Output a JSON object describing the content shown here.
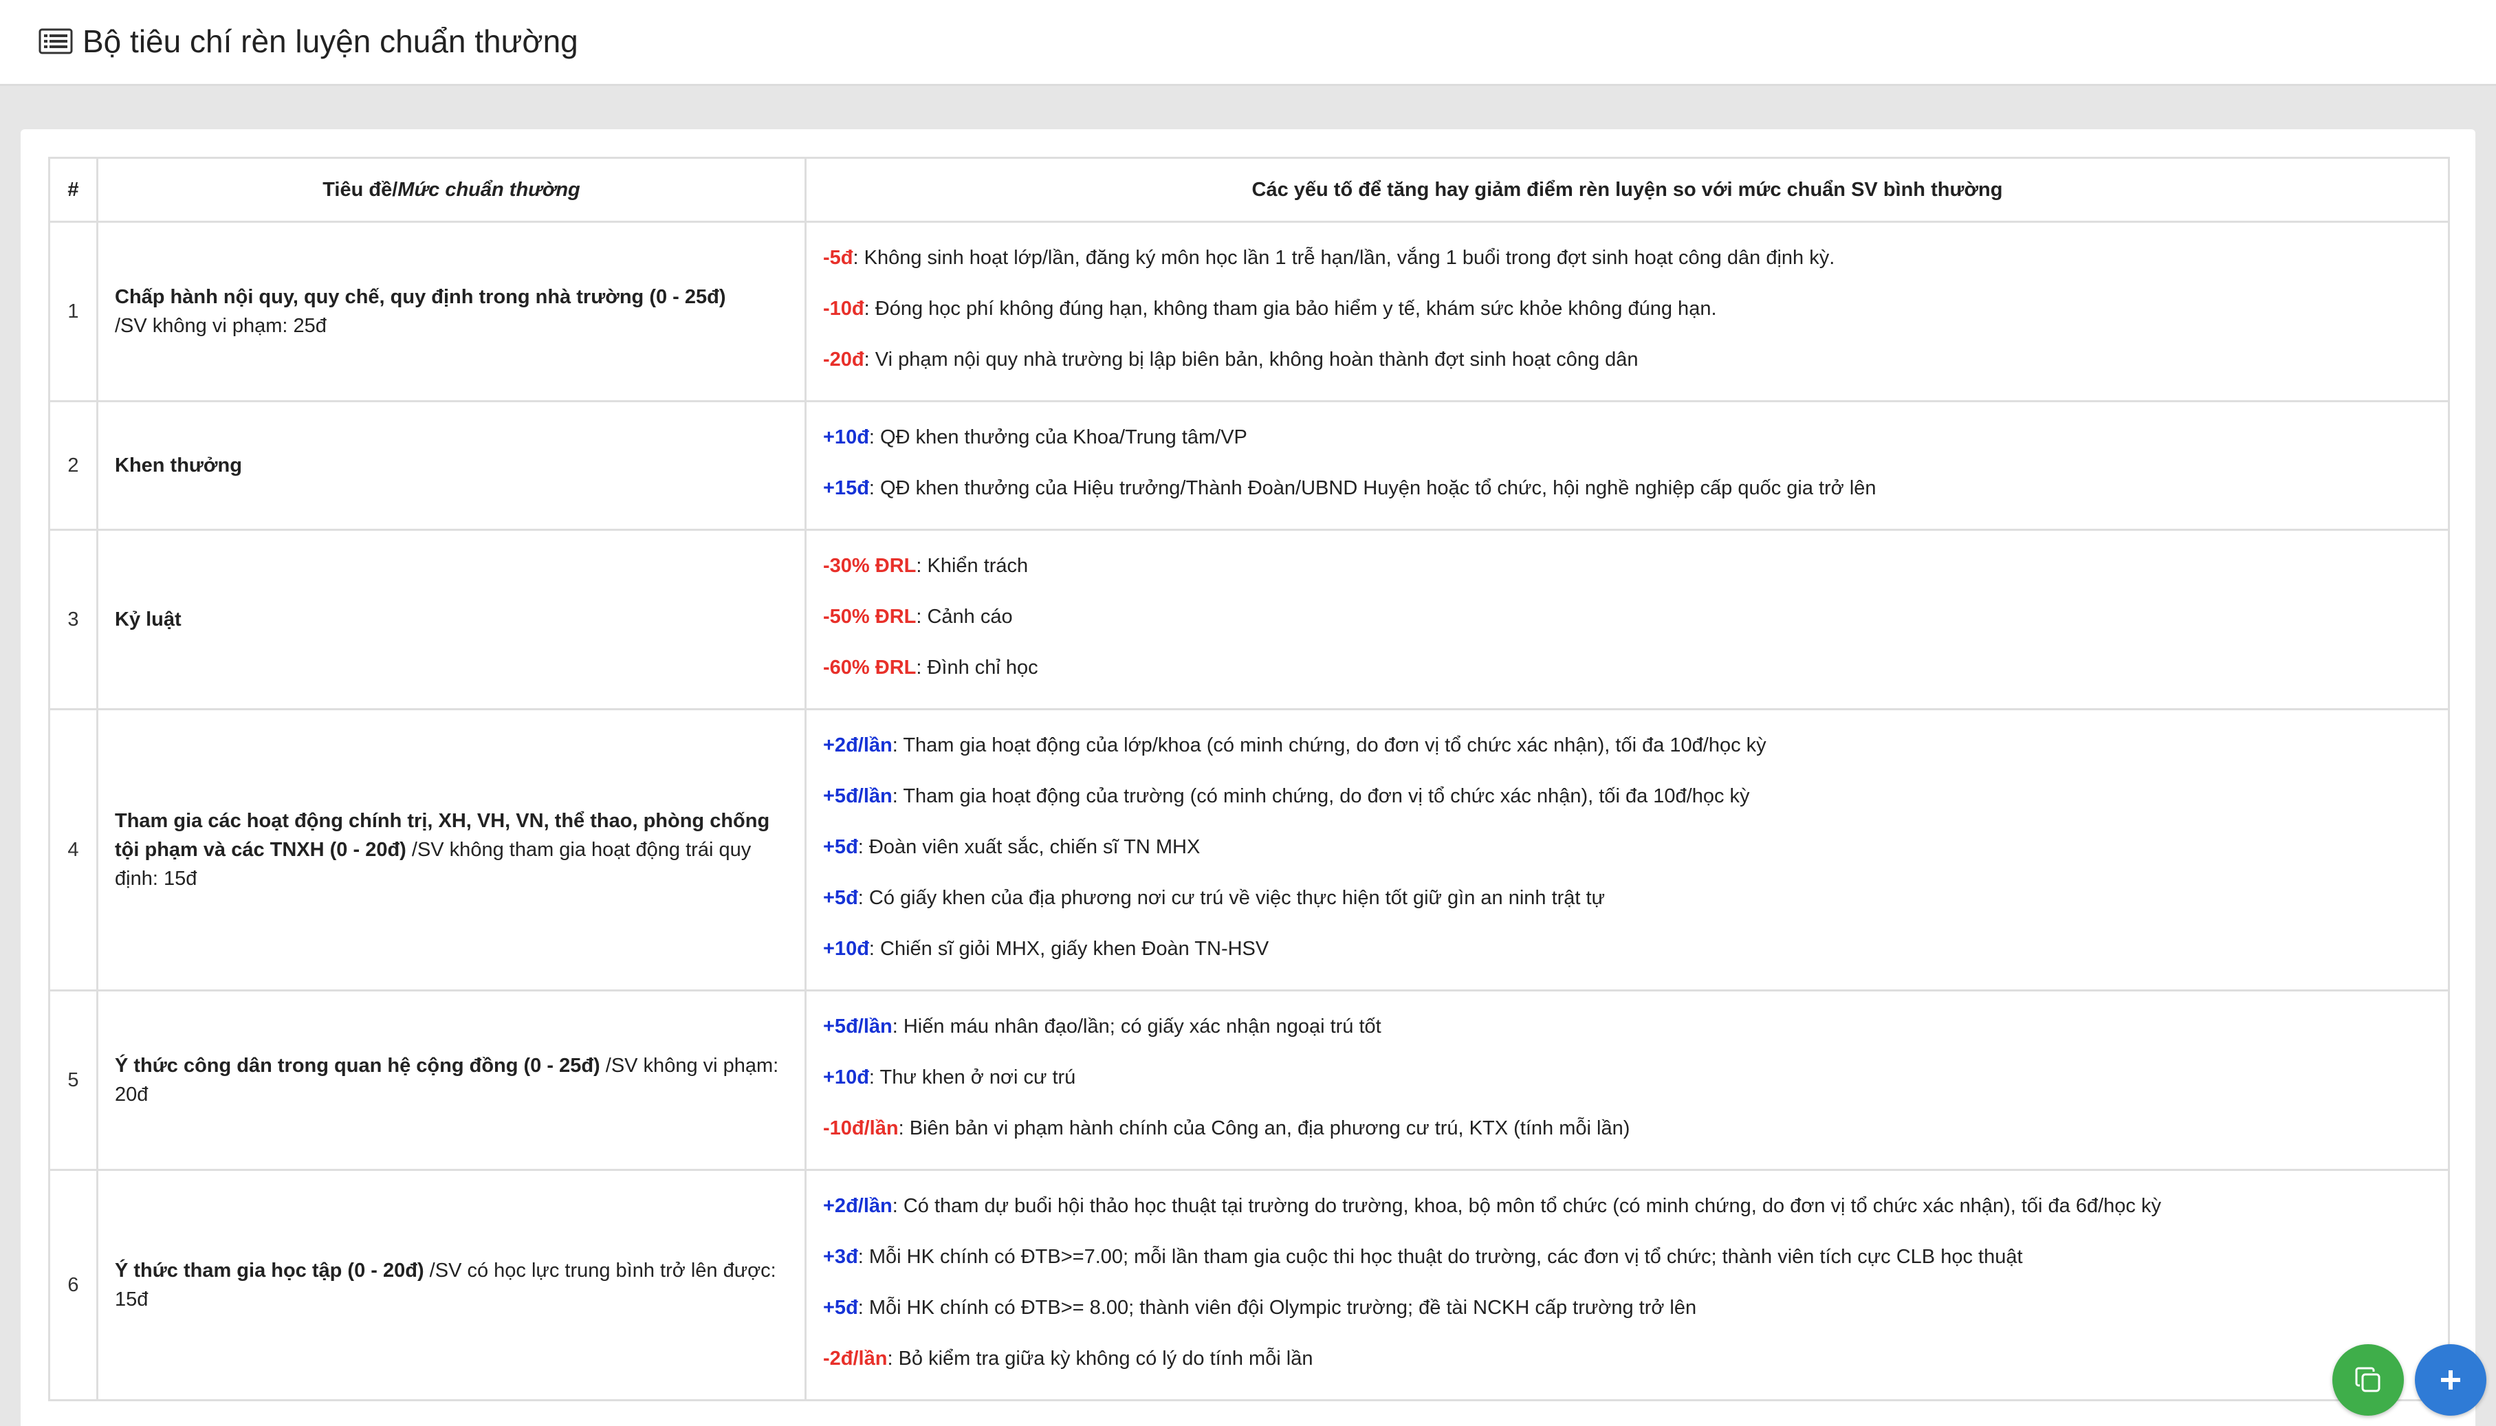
{
  "header": {
    "title": "Bộ tiêu chí rèn luyện chuẩn thường",
    "icon": "list-alt-icon"
  },
  "table": {
    "col_num": "#",
    "col_title_prefix": "Tiêu đề/",
    "col_title_italic": "Mức chuẩn thường",
    "col_factors": "Các yếu tố để tăng hay giảm điểm rèn luyện so với mức chuẩn SV bình thường",
    "rows": [
      {
        "num": "1",
        "title": "Chấp hành nội quy, quy chế, quy định trong nhà trường (0 - 25đ)",
        "norm": "/SV không vi phạm: 25đ",
        "factors": [
          {
            "value": "-5đ",
            "text": ": Không sinh hoạt lớp/lần, đăng ký môn học lần 1 trễ hạn/lần, vắng 1 buổi trong đợt sinh hoạt công dân định kỳ."
          },
          {
            "value": "-10đ",
            "text": ": Đóng học phí không đúng hạn, không tham gia bảo hiểm y tế, khám sức khỏe không đúng hạn."
          },
          {
            "value": "-20đ",
            "text": ": Vi phạm nội quy nhà trường bị lập biên bản, không hoàn thành đợt sinh hoạt công dân"
          }
        ]
      },
      {
        "num": "2",
        "title": "Khen thưởng",
        "norm": "",
        "factors": [
          {
            "value": "+10đ",
            "text": ": QĐ khen thưởng của Khoa/Trung tâm/VP"
          },
          {
            "value": "+15đ",
            "text": ": QĐ khen thưởng của Hiệu trưởng/Thành Đoàn/UBND Huyện hoặc tổ chức, hội nghề nghiệp cấp quốc gia trở lên"
          }
        ]
      },
      {
        "num": "3",
        "title": "Kỷ luật",
        "norm": "",
        "factors": [
          {
            "value": "-30% ĐRL",
            "text": ": Khiển trách"
          },
          {
            "value": "-50% ĐRL",
            "text": ": Cảnh cáo"
          },
          {
            "value": "-60% ĐRL",
            "text": ": Đình chỉ học"
          }
        ]
      },
      {
        "num": "4",
        "title": "Tham gia các hoạt động chính trị, XH, VH, VN, thể thao, phòng chống tội phạm và các TNXH (0 - 20đ)",
        "norm": " /SV không tham gia hoạt động trái quy định: 15đ",
        "factors": [
          {
            "value": "+2đ/lần",
            "text": ": Tham gia hoạt động của lớp/khoa (có minh chứng, do đơn vị tổ chức xác nhận), tối đa 10đ/học kỳ"
          },
          {
            "value": "+5đ/lần",
            "text": ": Tham gia hoạt động của trường (có minh chứng, do đơn vị tổ chức xác nhận), tối đa 10đ/học kỳ"
          },
          {
            "value": "+5đ",
            "text": ": Đoàn viên xuất sắc, chiến sĩ TN MHX"
          },
          {
            "value": "+5đ",
            "text": ": Có giấy khen của địa phương nơi cư trú về việc thực hiện tốt giữ gìn an ninh trật tự"
          },
          {
            "value": "+10đ",
            "text": ": Chiến sĩ giỏi MHX, giấy khen Đoàn TN-HSV"
          }
        ]
      },
      {
        "num": "5",
        "title": "Ý thức công dân trong quan hệ cộng đồng (0 - 25đ)",
        "norm": " /SV không vi phạm: 20đ",
        "factors": [
          {
            "value": "+5đ/lần",
            "text": ": Hiến máu nhân đạo/lần; có giấy xác nhận ngoại trú tốt"
          },
          {
            "value": "+10đ",
            "text": ": Thư khen ở nơi cư trú"
          },
          {
            "value": "-10đ/lần",
            "text": ": Biên bản vi phạm hành chính của Công an, địa phương cư trú, KTX (tính mỗi lần)"
          }
        ]
      },
      {
        "num": "6",
        "title": "Ý thức tham gia học tập (0 - 20đ)",
        "norm": " /SV có học lực trung bình trở lên được: 15đ",
        "factors": [
          {
            "value": "+2đ/lần",
            "text": ": Có tham dự buổi hội thảo học thuật tại trường do trường, khoa, bộ môn tổ chức (có minh chứng, do đơn vị tổ chức xác nhận), tối đa 6đ/học kỳ"
          },
          {
            "value": "+3đ",
            "text": ": Mỗi HK chính có ĐTB>=7.00; mỗi lần tham gia cuộc thi học thuật do trường, các đơn vị tổ chức; thành viên tích cực CLB học thuật"
          },
          {
            "value": "+5đ",
            "text": ": Mỗi HK chính có ĐTB>= 8.00; thành viên đội Olympic trường; đề tài NCKH cấp trường trở lên"
          },
          {
            "value": "-2đ/lần",
            "text": ": Bỏ kiểm tra giữa kỳ không có lý do tính mỗi lần"
          }
        ]
      }
    ]
  },
  "colors": {
    "negative": "#e8302a",
    "positive": "#1633d6",
    "fab_copy": "#3fae4a",
    "fab_add": "#2f7bd6"
  },
  "fabs": [
    {
      "icon": "copy-icon"
    },
    {
      "icon": "plus-icon"
    }
  ]
}
